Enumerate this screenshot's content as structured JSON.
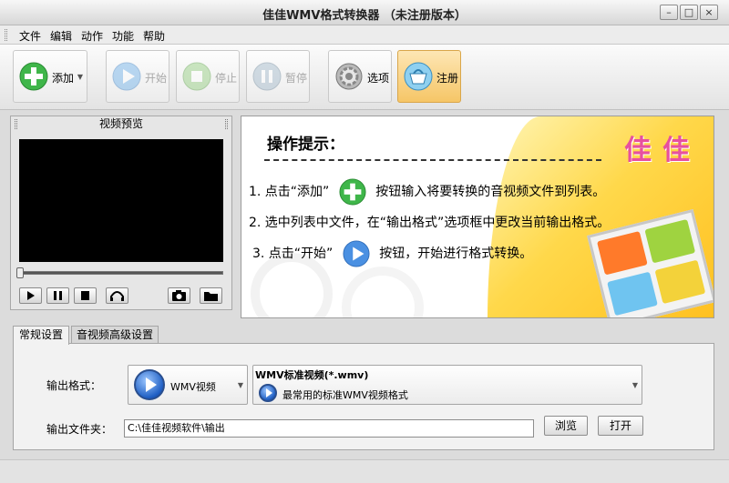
{
  "window": {
    "title": "佳佳WMV格式转换器  （未注册版本）",
    "controls": {
      "minimize": "–",
      "maximize": "□",
      "close": "×"
    }
  },
  "menu": [
    "文件",
    "编辑",
    "动作",
    "功能",
    "帮助"
  ],
  "toolbar": {
    "add": "添加",
    "start": "开始",
    "stop": "停止",
    "pause": "暂停",
    "options": "选项",
    "register": "注册"
  },
  "preview": {
    "title": "视频预览"
  },
  "tips": {
    "heading": "操作提示：",
    "step1_a": "1. 点击“添加”",
    "step1_b": "按钮输入将要转换的音视频文件到列表。",
    "step2": "2. 选中列表中文件，在“输出格式”选项框中更改当前输出格式。",
    "step3_a": "3. 点击“开始”",
    "step3_b": "按钮，开始进行格式转换。",
    "brand": "佳佳"
  },
  "tabs": [
    "常规设置",
    "音视频高级设置"
  ],
  "settings": {
    "output_format_label": "输出格式：",
    "format_name": "WMV视频",
    "format_title": "WMV标准视频(*.wmv)",
    "format_desc": "最常用的标准WMV视频格式",
    "output_folder_label": "输出文件夹：",
    "output_folder_value": "C:\\佳佳视频软件\\输出",
    "browse": "浏览",
    "open": "打开"
  },
  "colors": {
    "accent_yellow": "#ffc926",
    "brand_pink": "#e7509f",
    "add_green": "#3fb64a",
    "play_blue": "#1f5fc4"
  }
}
